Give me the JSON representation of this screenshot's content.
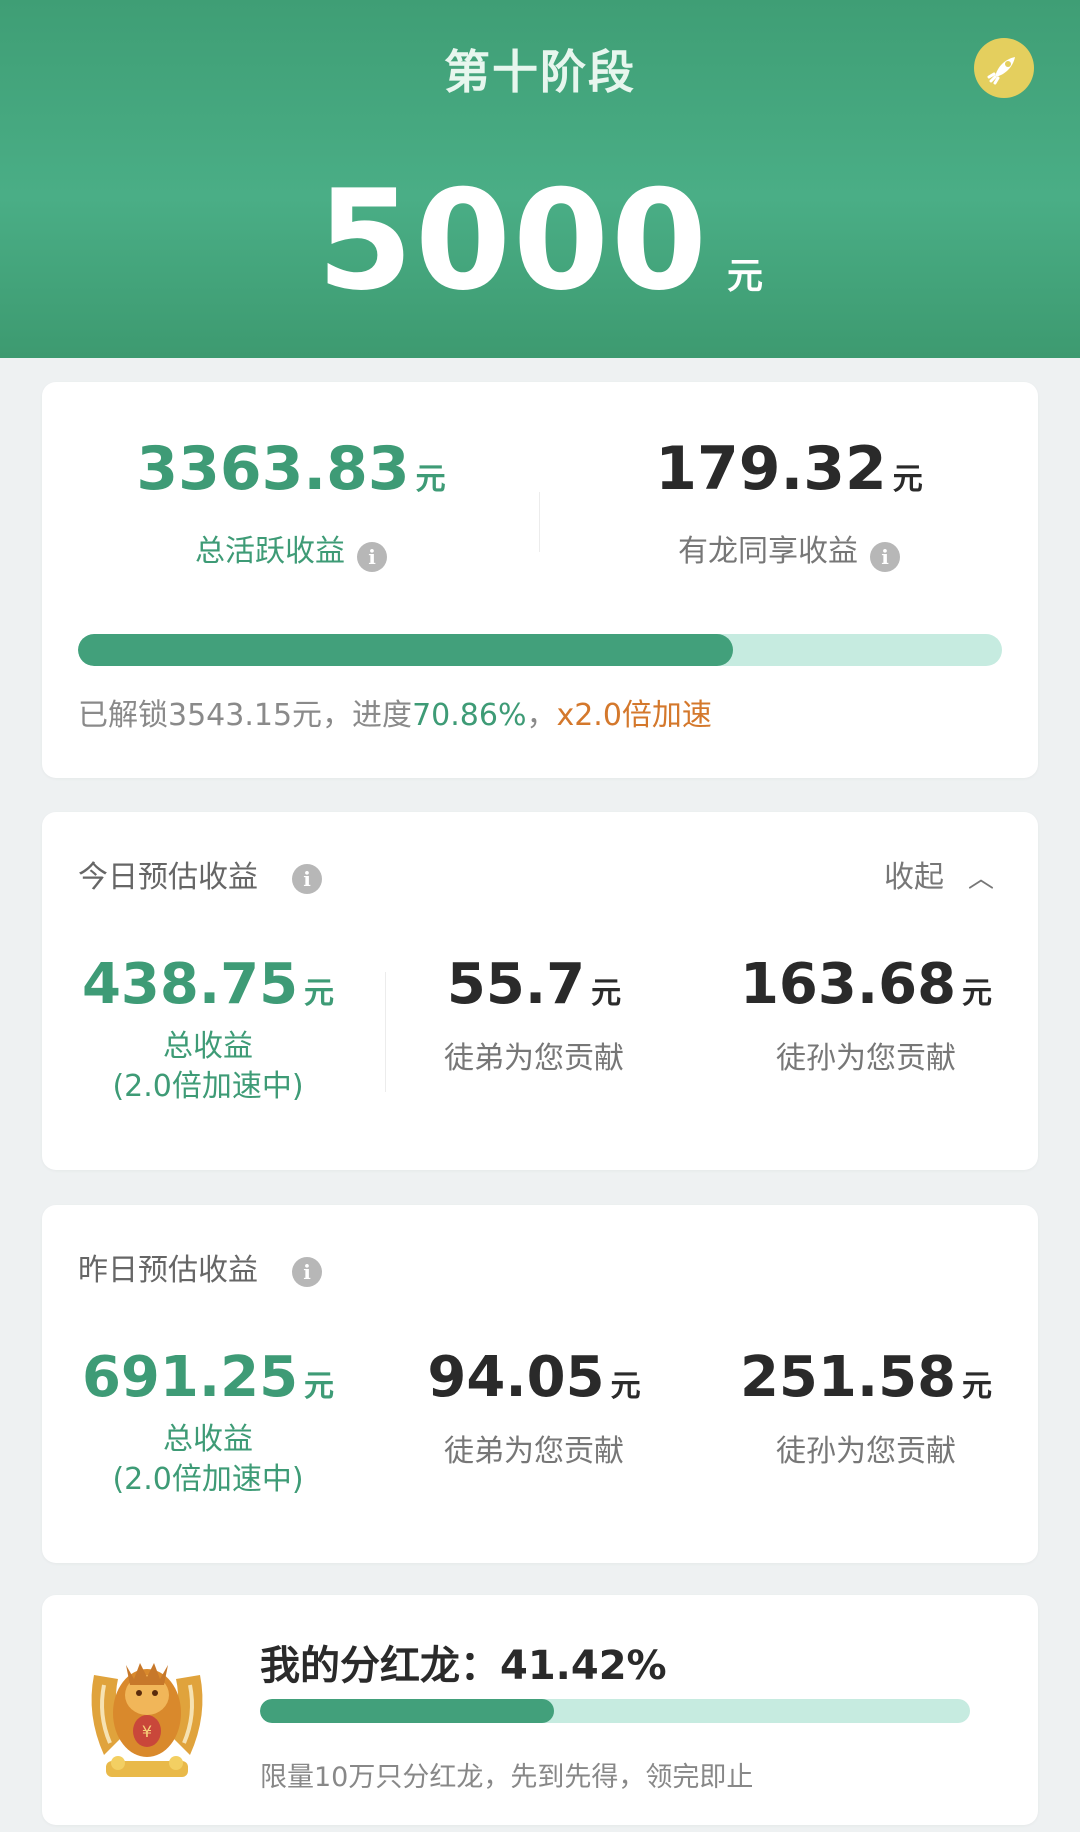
{
  "header": {
    "title": "第十阶段",
    "amount": "5000",
    "unit": "元",
    "action_icon": "rocket-icon"
  },
  "summary": {
    "active": {
      "amount": "3363.83",
      "unit": "元",
      "label": "总活跃收益"
    },
    "shared": {
      "amount": "179.32",
      "unit": "元",
      "label": "有龙同享收益"
    },
    "progress": {
      "percent": 70.86,
      "prefix": "已解锁",
      "unlocked": "3543.15元",
      "sep": "，进度",
      "percent_text": "70.86%",
      "sep2": "，",
      "boost": "x2.0倍加速"
    }
  },
  "today": {
    "title": "今日预估收益",
    "collapse_label": "收起",
    "total": {
      "amount": "438.75",
      "unit": "元",
      "label": "总收益",
      "sub": "(2.0倍加速中)"
    },
    "disciple": {
      "amount": "55.7",
      "unit": "元",
      "label": "徒弟为您贡献"
    },
    "grand": {
      "amount": "163.68",
      "unit": "元",
      "label": "徒孙为您贡献"
    }
  },
  "yesterday": {
    "title": "昨日预估收益",
    "total": {
      "amount": "691.25",
      "unit": "元",
      "label": "总收益",
      "sub": "(2.0倍加速中)"
    },
    "disciple": {
      "amount": "94.05",
      "unit": "元",
      "label": "徒弟为您贡献"
    },
    "grand": {
      "amount": "251.58",
      "unit": "元",
      "label": "徒孙为您贡献"
    }
  },
  "dividend": {
    "title": "我的分红龙：",
    "percent_text": "41.42%",
    "percent": 41.42,
    "note": "限量10万只分红龙，先到先得，领完即止",
    "image_icon": "dragon-icon"
  },
  "colors": {
    "brand_green": "#3e9b76",
    "header_green": "#4aae86",
    "track": "#c6ebe0",
    "boost_orange": "#d4782c",
    "rocket_yellow": "#e4cf5e"
  }
}
